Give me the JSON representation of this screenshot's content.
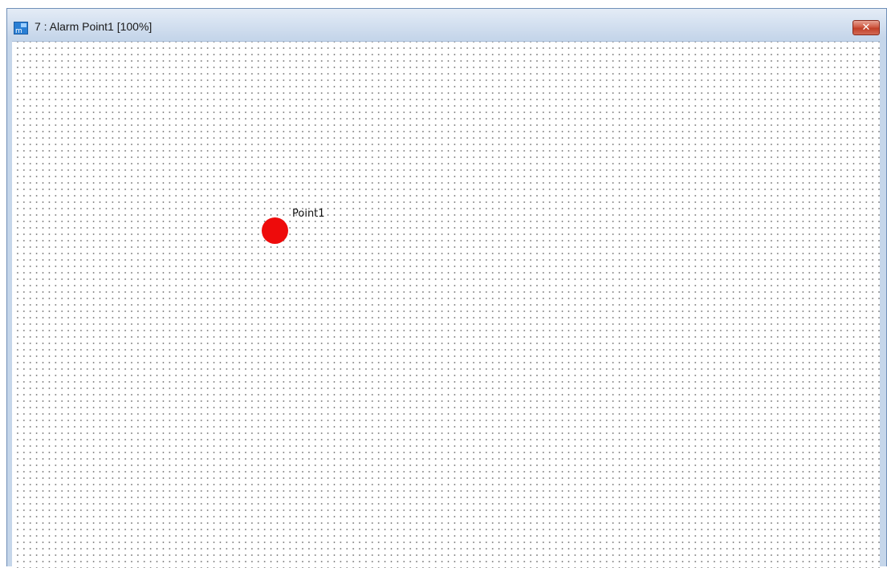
{
  "window": {
    "title": "7 : Alarm Point1 [100%]",
    "app_icon": "app-icon",
    "close_label": "✕",
    "close_icon": "close-icon"
  },
  "canvas": {
    "grid": "dotted",
    "points": [
      {
        "label": "Point1",
        "status_color": "#ee0b0b"
      }
    ]
  },
  "colors": {
    "titlebar": "#d6e2f1",
    "close_button": "#c13f28",
    "alarm": "#ee0b0b"
  }
}
